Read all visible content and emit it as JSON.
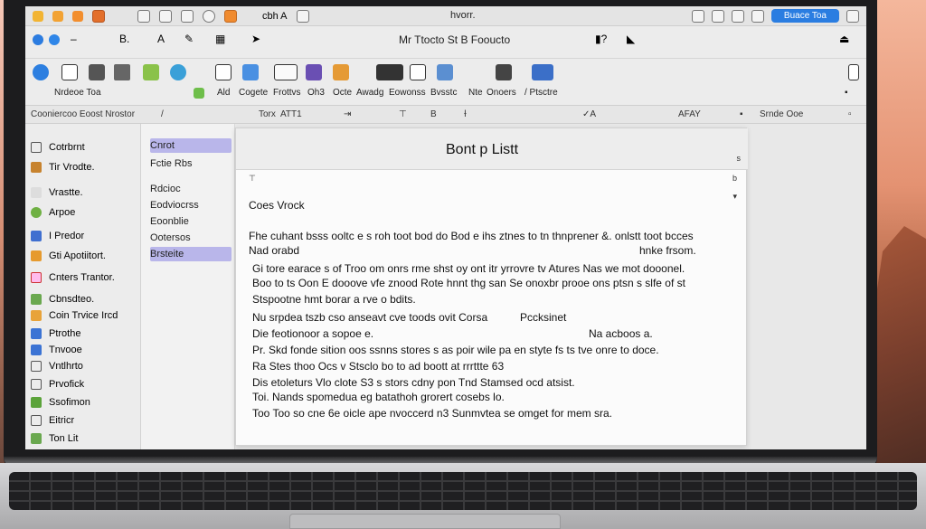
{
  "menubar": {
    "title": "hvorr.",
    "right_button": "Buace Toa"
  },
  "titlebar": {
    "app_label": "cbh A",
    "doc_title": "Mr Ttocto St B Fooucto"
  },
  "toolbar": {
    "left_label": "Nrdeoe Toa",
    "items": [
      "Ald",
      "Cogete",
      "Frottvs",
      "Oh3",
      "Octe",
      "Awadg",
      "Eowonss",
      "Bvsstc",
      "Nte",
      "Onoers",
      "/ Ptsctre"
    ]
  },
  "ruler": {
    "left": "Cooniercoo Eoost Nrostor",
    "a": "Torx",
    "b": "ATT1",
    "c": "AFAY",
    "d": "Srnde Ooe"
  },
  "sidebar": {
    "items": [
      "Cotrbrnt",
      "Tir Vrodte.",
      "Vrastte.",
      "Arpoe",
      "I Predor",
      "Gti Apotiitort.",
      "Cnters Trantor.",
      "Cbnsdteo.",
      "Coin Trvice Ircd",
      "Ptrothe",
      "Tnvooe",
      "Vntlhrto",
      "Prvofick",
      "Ssofimon",
      "Eitricr",
      "Ton Lit"
    ]
  },
  "panel2": {
    "items": [
      "Cnrot",
      "Fctie Rbs",
      "Rdcioc",
      "Eodviocrss",
      "Eoonblie",
      "Ootersos",
      "Brsteite"
    ]
  },
  "document": {
    "heading": "Bont p Listt",
    "subheading": "Coes Vrock",
    "lines": [
      "Fhe cuhant bsss ooltc e s roh toot bod do Bod e ihs ztnes to tn thnprener &. onlstt toot bcces",
      "Nad orabd",
      "hnke frsom.",
      "Gi tore earace s of Troo om onrs rme shst oy ont itr yrrovre tv Atures Nas we mot dooonel.",
      "Boo to ts Oon E dooove vfe znood Rote hnnt thg san Se onoxbr prooe ons ptsn s slfe of st",
      "Stspootne hmt borar a rve o bdits.",
      "Nu srpdea tszb cso anseavt cve toods ovit Corsa",
      "Pccksinet",
      "Die feotionoor a sopoe e.",
      "Na acboos a.",
      "Pr. Skd fonde sition oos ssnns stores s as poir wile pa en styte fs ts tve onre to doce.",
      "Ra Stes thoo Ocs v Stsclo bo to ad boott at rrrttte 63",
      "Dis etoleturs Vlo clote S3 s stors cdny pon Tnd Stamsed ocd atsist.",
      "Toi. Nands spomedua eg batathoh grorert cosebs lo.",
      "Too Too so cne 6e oicle ape nvoccerd n3 Sunmvtea se omget for mem sra."
    ],
    "scroll_s": "s",
    "scroll_b": "b"
  }
}
